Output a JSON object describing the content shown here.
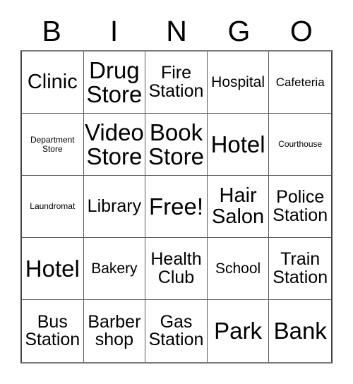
{
  "card": {
    "title": "BINGO",
    "header_letters": [
      "B",
      "I",
      "N",
      "G",
      "O"
    ],
    "free_space_label": "Free!",
    "columns": 5,
    "rows": 5,
    "grid_line_color": "#5a5a5a",
    "border_color": "#444444",
    "text_color": "#000000",
    "background_color": "#ffffff",
    "cells": [
      {
        "text": "Clinic",
        "size": "xl"
      },
      {
        "text": "Drug\nStore",
        "size": "xxl"
      },
      {
        "text": "Fire\nStation",
        "size": "lg"
      },
      {
        "text": "Hospital",
        "size": "md"
      },
      {
        "text": "Cafeteria",
        "size": "sm"
      },
      {
        "text": "Department\nStore",
        "size": "xs"
      },
      {
        "text": "Video\nStore",
        "size": "xxl"
      },
      {
        "text": "Book\nStore",
        "size": "xxl"
      },
      {
        "text": "Hotel",
        "size": "xxl"
      },
      {
        "text": "Courthouse",
        "size": "xs"
      },
      {
        "text": "Laundromat",
        "size": "xs"
      },
      {
        "text": "Library",
        "size": "lg"
      },
      {
        "text": "Free!",
        "size": "xxl"
      },
      {
        "text": "Hair\nSalon",
        "size": "xl"
      },
      {
        "text": "Police\nStation",
        "size": "lg"
      },
      {
        "text": "Hotel",
        "size": "xxl"
      },
      {
        "text": "Bakery",
        "size": "md"
      },
      {
        "text": "Health\nClub",
        "size": "lg"
      },
      {
        "text": "School",
        "size": "md"
      },
      {
        "text": "Train\nStation",
        "size": "lg"
      },
      {
        "text": "Bus\nStation",
        "size": "lg"
      },
      {
        "text": "Barber\nshop",
        "size": "lg"
      },
      {
        "text": "Gas\nStation",
        "size": "lg"
      },
      {
        "text": "Park",
        "size": "xxl"
      },
      {
        "text": "Bank",
        "size": "xxl"
      }
    ]
  }
}
